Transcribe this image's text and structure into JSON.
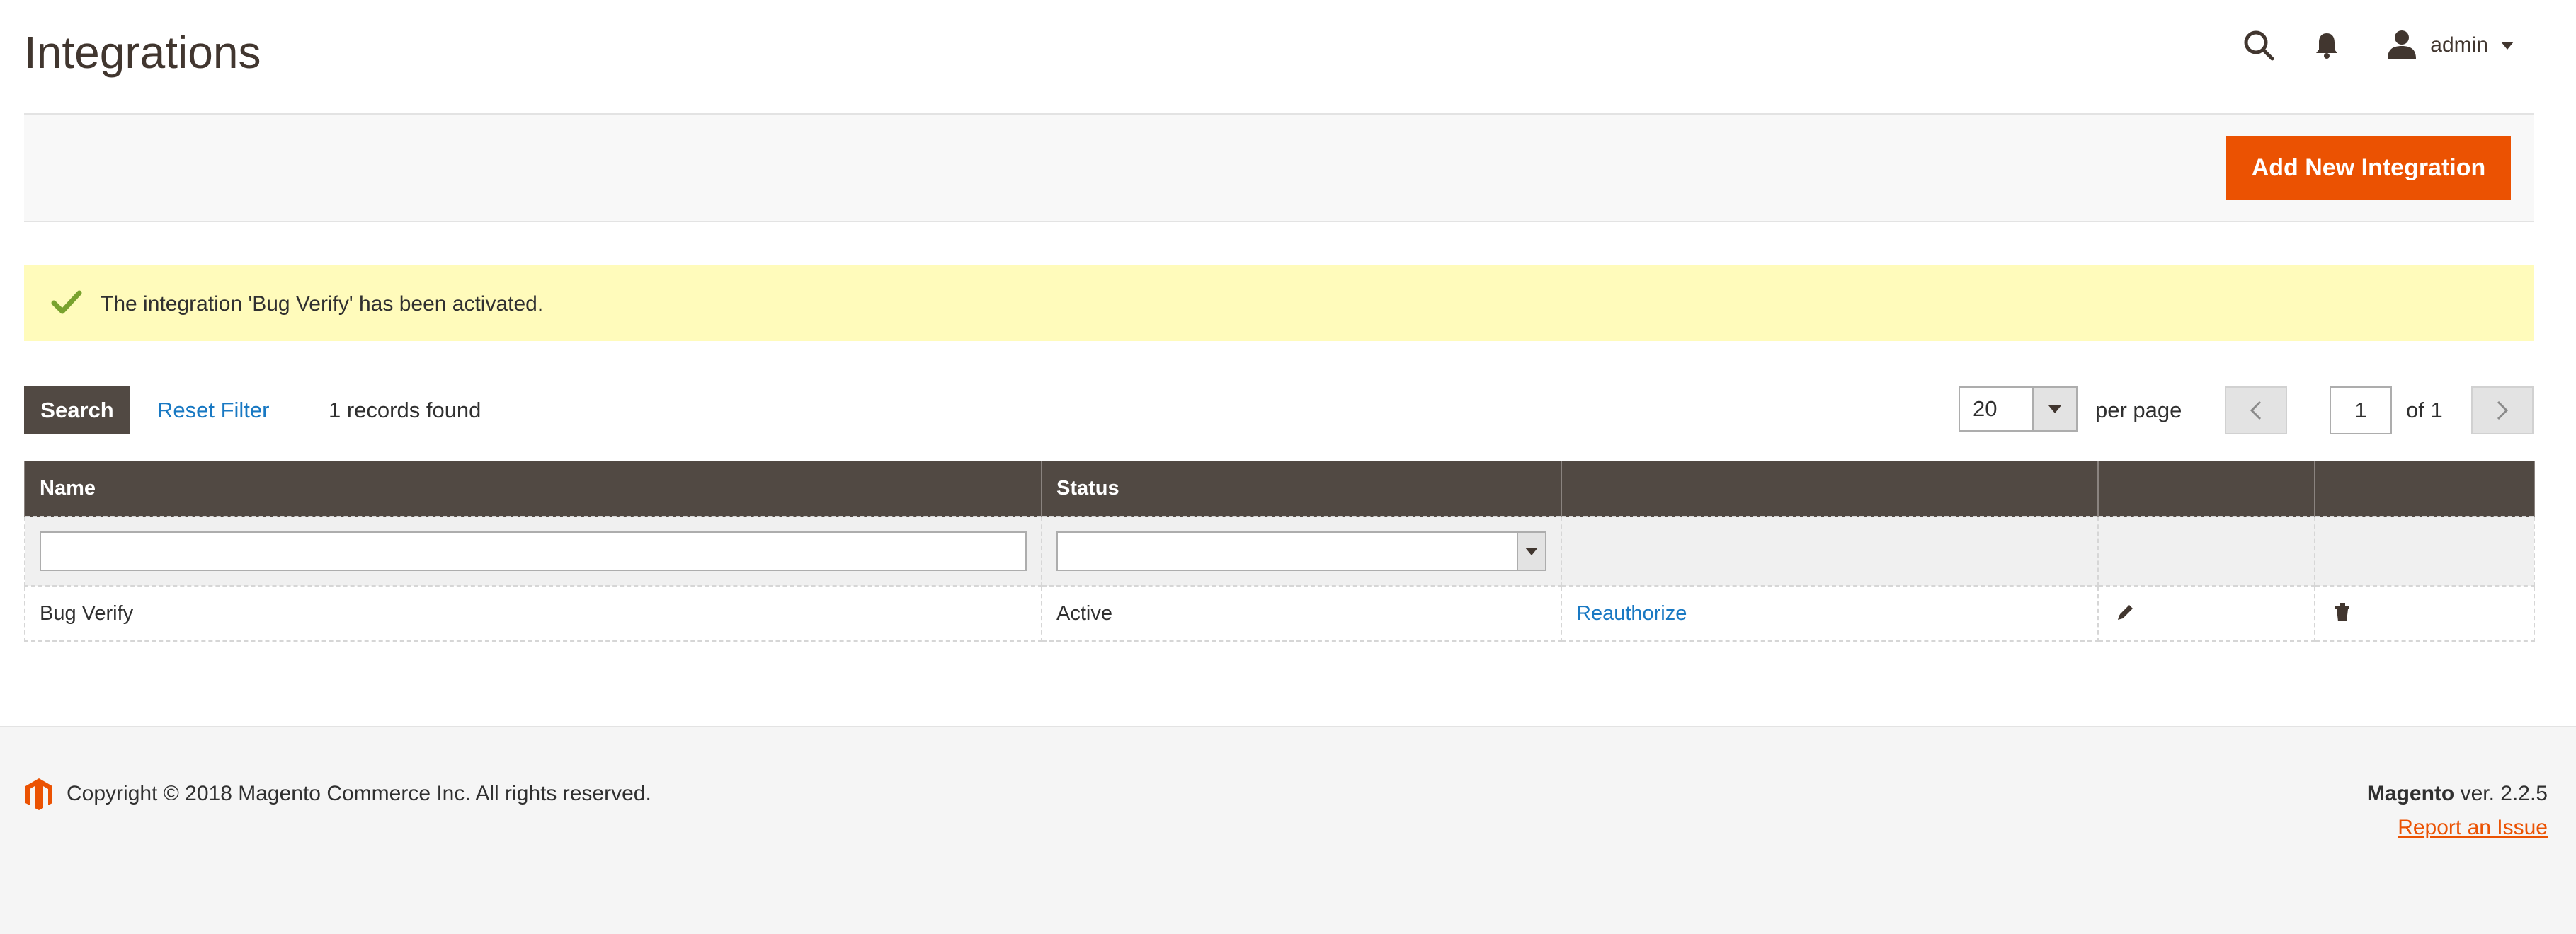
{
  "page": {
    "title": "Integrations"
  },
  "header": {
    "search_icon": "search-icon",
    "notifications_icon": "bell-icon",
    "user_icon": "user-icon",
    "user_name": "admin"
  },
  "actions": {
    "add_button": "Add New Integration"
  },
  "message": {
    "text": "The integration 'Bug Verify' has been activated.",
    "icon": "checkmark-icon"
  },
  "toolbar": {
    "search_button": "Search",
    "reset_filter": "Reset Filter",
    "records_found": "1 records found",
    "per_page_value": "20",
    "per_page_label": "per page",
    "current_page": "1",
    "page_of": "of 1"
  },
  "grid": {
    "columns": [
      "Name",
      "Status",
      "",
      "",
      ""
    ],
    "rows": [
      {
        "name": "Bug Verify",
        "status": "Active",
        "action": "Reauthorize",
        "edit_icon": "pencil-icon",
        "delete_icon": "trash-icon"
      }
    ]
  },
  "footer": {
    "copyright": "Copyright © 2018 Magento Commerce Inc. All rights reserved.",
    "brand": "Magento",
    "version": "ver. 2.2.5",
    "report_issue": "Report an Issue"
  },
  "colors": {
    "accent": "#eb5202",
    "header_dark": "#514943",
    "link": "#1979c3",
    "message_bg": "#fffbbb",
    "success_icon": "#79a22e"
  }
}
